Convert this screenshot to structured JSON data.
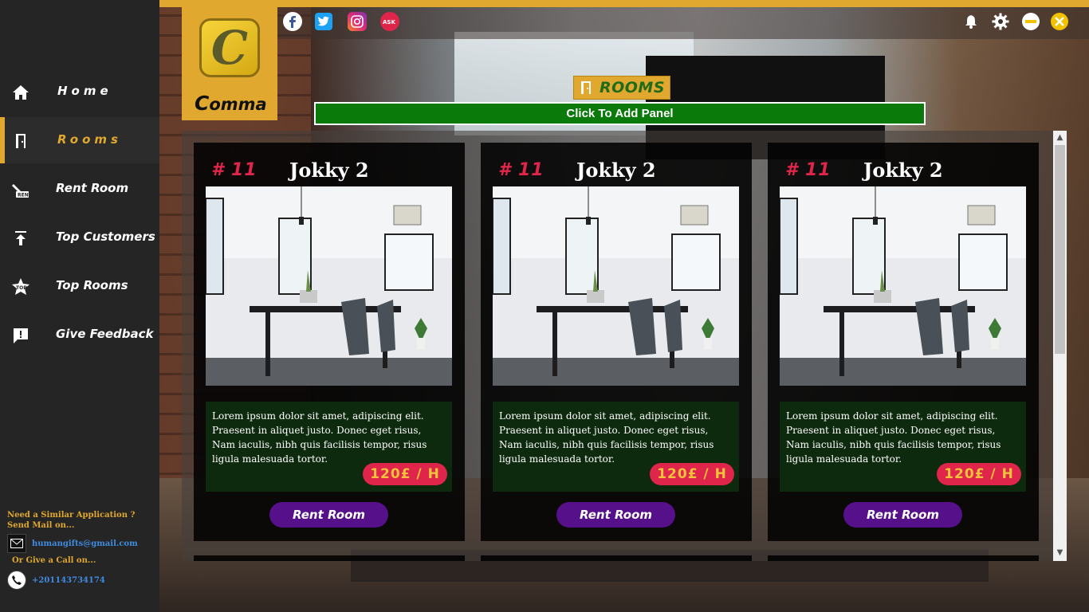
{
  "app": {
    "brand": "omma",
    "brand_initial": "C"
  },
  "sidebar": {
    "items": [
      {
        "label": "Home",
        "icon": "home-icon",
        "active": false
      },
      {
        "label": "Rooms",
        "icon": "door-icon",
        "active": true
      },
      {
        "label": "Rent Room",
        "icon": "rent-icon",
        "active": false
      },
      {
        "label": "Top Customers",
        "icon": "upload-arrow-icon",
        "active": false
      },
      {
        "label": "Top Rooms",
        "icon": "top-star-icon",
        "active": false
      },
      {
        "label": "Give Feedback",
        "icon": "feedback-icon",
        "active": false
      }
    ],
    "contact": {
      "line1": "Need a Similar Application ?",
      "line2": "Send Mail on...",
      "email": "humangifts@gmail.com",
      "line3": "Or Give a Call on...",
      "phone": "+201143734174"
    }
  },
  "topbar": {
    "social_icons": [
      "facebook-icon",
      "twitter-icon",
      "instagram-icon",
      "ask-fm-icon"
    ],
    "window_buttons": [
      "bell-icon",
      "gear-icon",
      "minimize-icon",
      "close-icon"
    ]
  },
  "page": {
    "title": "ROOMS",
    "add_panel_label": "Click To Add Panel"
  },
  "rooms": [
    {
      "number": "# 11",
      "name": "Jokky 2",
      "description": "Lorem ipsum dolor sit amet, adipiscing elit. Praesent in aliquet justo. Donec eget risus, Nam iaculis, nibh quis facilisis tempor, risus ligula malesuada tortor.",
      "price": "120£ / H",
      "button": "Rent Room"
    },
    {
      "number": "# 11",
      "name": "Jokky 2",
      "description": "Lorem ipsum dolor sit amet, adipiscing elit. Praesent in aliquet justo. Donec eget risus, Nam iaculis, nibh quis facilisis tempor, risus ligula malesuada tortor.",
      "price": "120£ / H",
      "button": "Rent Room"
    },
    {
      "number": "# 11",
      "name": "Jokky 2",
      "description": "Lorem ipsum dolor sit amet, adipiscing elit. Praesent in aliquet justo. Donec eget risus, Nam iaculis, nibh quis facilisis tempor, risus ligula malesuada tortor.",
      "price": "120£ / H",
      "button": "Rent Room"
    }
  ],
  "colors": {
    "accent": "#e0a82e",
    "sidebar_bg": "#252525",
    "price_bg": "#e0254a",
    "rent_button": "#55108a",
    "add_panel": "#0a7a0a"
  }
}
